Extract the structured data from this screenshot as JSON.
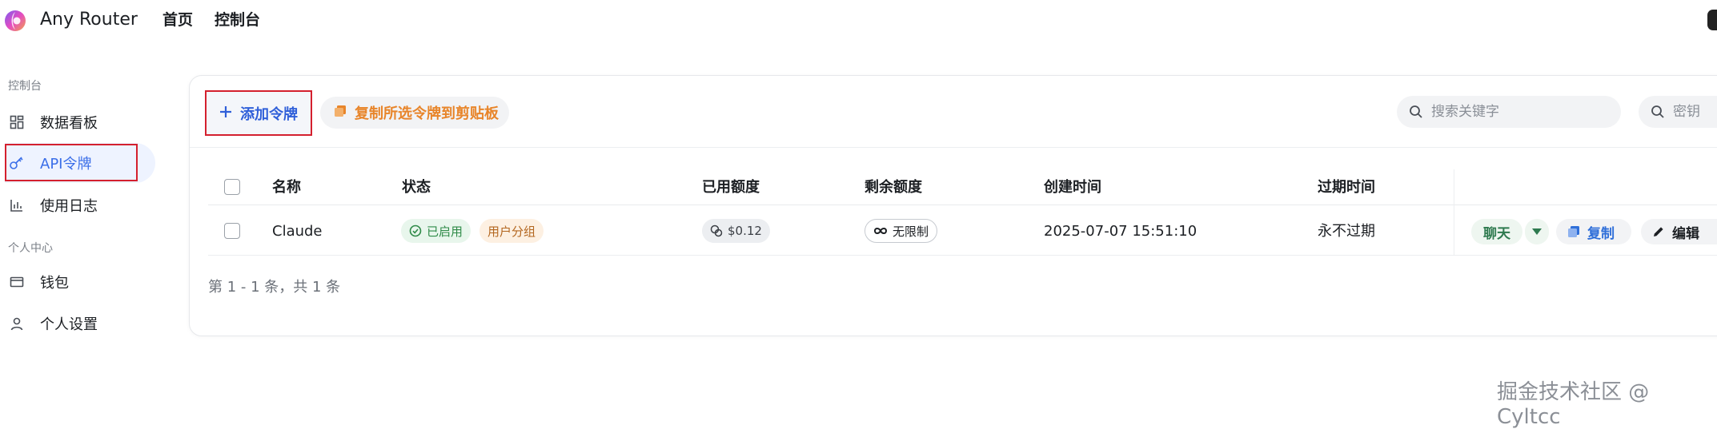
{
  "header": {
    "app_title": "Any Router",
    "nav": [
      {
        "label": "首页"
      },
      {
        "label": "控制台"
      }
    ]
  },
  "sidebar": {
    "sections": [
      {
        "title": "控制台",
        "items": [
          {
            "label": "数据看板",
            "icon": "dashboard-grid-icon"
          },
          {
            "label": "API令牌",
            "icon": "key-icon",
            "active": true
          },
          {
            "label": "使用日志",
            "icon": "bar-chart-icon"
          }
        ]
      },
      {
        "title": "个人中心",
        "items": [
          {
            "label": "钱包",
            "icon": "wallet-icon"
          },
          {
            "label": "个人设置",
            "icon": "user-icon"
          }
        ]
      }
    ]
  },
  "toolbar": {
    "add_label": "添加令牌",
    "copy_selected_label": "复制所选令牌到剪贴板",
    "search_placeholder": "搜索关键字",
    "key_placeholder": "密钥"
  },
  "table": {
    "columns": [
      "名称",
      "状态",
      "已用额度",
      "剩余额度",
      "创建时间",
      "过期时间"
    ],
    "rows": [
      {
        "name": "Claude",
        "status": "已启用",
        "group": "用户分组",
        "used": "$0.12",
        "remaining": "无限制",
        "created": "2025-07-07 15:51:10",
        "expires": "永不过期",
        "actions": {
          "chat": "聊天",
          "copy": "复制",
          "edit": "编辑"
        }
      }
    ]
  },
  "pagination": {
    "summary": "第 1 - 1 条，共 1 条"
  },
  "watermark": "掘金技术社区 @ Cyltcc",
  "colors": {
    "accent_blue": "#2f5fd9",
    "active_bg": "#eef3ff",
    "orange": "#e8852a",
    "green": "#2e8a47",
    "highlight_red": "#d4202e"
  }
}
